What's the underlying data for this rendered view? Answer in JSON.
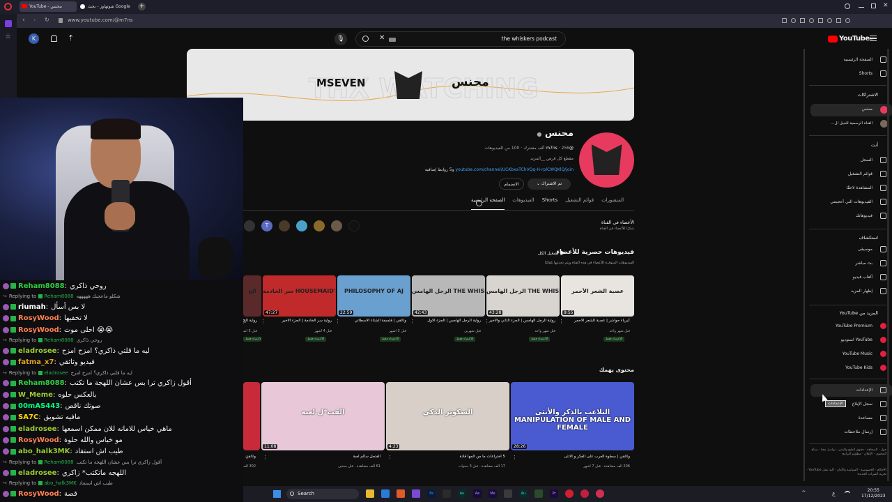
{
  "browser": {
    "tabs": [
      {
        "label": "YouTube - محنس"
      },
      {
        "label": "شوتهاوز - بحث Google"
      }
    ],
    "new_tab_symbol": "+",
    "url": "www.youtube.com/@m7ns",
    "profile_initial": "K"
  },
  "search": {
    "query": "the whiskers podcast"
  },
  "youtube_logo": {
    "text": "YouTube",
    "region": "SA"
  },
  "channel": {
    "name": "محنس",
    "handle": "@m7ns",
    "stats": "256 ألف مشترك · 100 من الفيديوهات",
    "description": "مقطع كل فرص __المزيد",
    "link": "youtube.com/channel/UCKbxaTChVQq-H-rplCWQKlQ/join",
    "link_suffix": "و5 روابط إضافية",
    "subscribed_label": "تم الاشتراك",
    "join_label": "الانضمام",
    "banner_logos": [
      "MSEVEN",
      "محنس"
    ],
    "tabs": [
      "الصفحة الرئيسية",
      "الفيديوهات",
      "Shorts",
      "قوائم التشغيل",
      "المنشورات"
    ]
  },
  "members": {
    "title": "الأعضاء في القناة",
    "subtitle": "شكرًا للأعضاء في القناة",
    "avatar_letter": "T"
  },
  "members_section": {
    "title": "فيديوهات حصرية للأعضاء",
    "play_all": "تشغيل الكل",
    "subtitle": "الفيديوهات المتوفرة للأعضاء في هذه القناة ويتم تحديثها تلقائيًا",
    "videos": [
      {
        "title": "كبرياء حواشر | عصبة الشعر الأحمر",
        "meta": "قبل شهر واحد",
        "duration": "9:55",
        "thumb_text": "عصبة الشعر الأحمر",
        "badge": "للأعضاء فقط"
      },
      {
        "title": "رواية الرجل الهامس | الجزء الثاني والأخير",
        "meta": "قبل شهر واحد",
        "duration": "43:28",
        "thumb_text": "الرجل الهامس THE WHISPER MAN",
        "badge": "للأعضاء فقط"
      },
      {
        "title": "رواية الرجل الهامس | الجزء الأول",
        "meta": "قبل شهرين",
        "duration": "42:43",
        "thumb_text": "الرجل الهامس THE WHISPER MAN",
        "badge": "للأعضاء فقط"
      },
      {
        "title": "وثائقي | فلسفة الشتاء الأسطاتي",
        "meta": "قبل 3 أشهر",
        "duration": "22:59",
        "thumb_text": "PHILOSOPHY OF AJ",
        "badge": "للأعضاء فقط"
      },
      {
        "title": "رواية سر الخادمة | الجزء الأخير",
        "meta": "قبل 4 أشهر",
        "duration": "47:27",
        "thumb_text": "سر الخادمة HOUSEMAID'S SECRET",
        "badge": "للأعضاء فقط"
      },
      {
        "title": "رواية الح",
        "meta": "قبل 5 أشهر",
        "duration": "",
        "thumb_text": "الح",
        "badge": "للأعضاء فقط"
      }
    ]
  },
  "for_you": {
    "title": "محتوى يهمك",
    "videos": [
      {
        "title": "وثائقي | سطوة العرب على الفكر و الأنثى",
        "meta": "206 ألف مشاهدة · قبل 7 أشهر",
        "duration": "28:26",
        "thumb_text": "التلاعب بالذكر والأنثى MANIPULATION OF MALE AND FEMALE"
      },
      {
        "title": "5 اختراعات ما من المها قادة",
        "meta": "17 ألف مشاهدة · قبل 3 سنوات",
        "duration": "4:23",
        "thumb_text": "السكوتر الذكي"
      },
      {
        "title": "الفتحل سالم لعبة",
        "meta": "61 ألف مشاهدة · قبل سنتين",
        "duration": "11:08",
        "thumb_text": "القت*ل لعبه"
      },
      {
        "title": "وثائقي",
        "meta": "302 ألف",
        "duration": "",
        "thumb_text": ""
      }
    ]
  },
  "sidebar": {
    "main": [
      {
        "label": "الصفحة الرئيسية",
        "icon": "home-icon"
      },
      {
        "label": "Shorts",
        "icon": "shorts-icon"
      }
    ],
    "subscriptions_header": "الاشتراكات",
    "subscriptions": [
      {
        "label": "محنس"
      },
      {
        "label": "القناة الرسمية للجيل ال..."
      }
    ],
    "you_header": "أنت",
    "you": [
      {
        "label": "السجل",
        "icon": "history-icon"
      },
      {
        "label": "قوائم التشغيل",
        "icon": "playlist-icon"
      },
      {
        "label": "المشاهدة لاحقًا",
        "icon": "clock-icon"
      },
      {
        "label": "الفيديوهات التي أعجبتني",
        "icon": "like-icon"
      },
      {
        "label": "فيديوهاتك",
        "icon": "video-icon"
      }
    ],
    "explore_header": "استكشاف",
    "explore": [
      {
        "label": "موسيقى",
        "icon": "music-icon"
      },
      {
        "label": "بث مباشر",
        "icon": "live-icon"
      },
      {
        "label": "ألعاب فيديو",
        "icon": "game-icon"
      },
      {
        "label": "إظهار المزيد",
        "icon": "chevron-down-icon"
      }
    ],
    "more_header": "المزيد من YouTube",
    "more": [
      {
        "label": "YouTube Premium"
      },
      {
        "label": "استوديو YouTube"
      },
      {
        "label": "YouTube Music"
      },
      {
        "label": "YouTube Kids"
      }
    ],
    "settings": [
      {
        "label": "الإعدادات",
        "icon": "gear-icon"
      },
      {
        "label": "سجل الإبلاغ",
        "icon": "flag-icon"
      },
      {
        "label": "مساعدة",
        "icon": "help-icon"
      },
      {
        "label": "إرسال ملاحظات",
        "icon": "feedback-icon"
      }
    ],
    "tooltip": "الإعدادات",
    "footer": "حول · الصحافة · حقوق الطبع والنشر · تواصل معنا · صناع المحتوى · الإعلان · مطوّرو البرامج",
    "footer2": "الأحكام · الخصوصية · السياسة والأمان · آلية عمل YouTube · تجربة الميزات الجديدة"
  },
  "chat": [
    {
      "type": "msg",
      "user": "Reham8088",
      "color": "#2ecc40",
      "text": "روحي ذاكري"
    },
    {
      "type": "reply",
      "to": "Reham8088",
      "text": "شكلو ماعجبك هههههه"
    },
    {
      "type": "msg",
      "user": "riumah",
      "color": "#ffffff",
      "text": "لا بس أسأل"
    },
    {
      "type": "msg",
      "user": "RosyWood",
      "color": "#ff7f50",
      "text": "لا تخفيها"
    },
    {
      "type": "msg",
      "user": "RosyWood",
      "color": "#ff7f50",
      "text": "احلى موت 😭😭"
    },
    {
      "type": "reply",
      "to": "Reham8088",
      "text": "روحي ذاكري"
    },
    {
      "type": "msg",
      "user": "eladrosee",
      "color": "#9acd32",
      "text": "ليه ما قلتي ذاكري؟ امزح امزح"
    },
    {
      "type": "msg",
      "user": "fatma_x7",
      "color": "#daa520",
      "text": "فيديو وثائقي"
    },
    {
      "type": "reply",
      "to": "eladrosee",
      "text": "ليه ما قلتي ذاكري؟ امزح امزح"
    },
    {
      "type": "msg",
      "user": "Reham8088",
      "color": "#2ecc40",
      "text": "أقول زاكري ترا بس عشان اللهجة ما تكتب"
    },
    {
      "type": "msg",
      "user": "W_Meme",
      "color": "#9acd32",
      "text": "بالعكس حلوه"
    },
    {
      "type": "msg",
      "user": "00mAS443",
      "color": "#00ff7f",
      "text": "صوتك ناقص"
    },
    {
      "type": "msg",
      "user": "SA7C",
      "color": "#ffd700",
      "text": "مافيه تشويق"
    },
    {
      "type": "msg",
      "user": "eladrosee",
      "color": "#9acd32",
      "text": "ماهي خياس للامانه للان ممكن اسمعها"
    },
    {
      "type": "msg",
      "user": "RosyWood",
      "color": "#ff7f50",
      "text": "مو خياس والله حلوة"
    },
    {
      "type": "msg",
      "user": "abo_halk3MK",
      "color": "#9acd32",
      "text": "طيب اش استفاد"
    },
    {
      "type": "reply",
      "to": "Reham8088",
      "text": "أقول زاكري ترا بس عشان اللهجة ما تكتب"
    },
    {
      "type": "msg",
      "user": "eladrosee",
      "color": "#9acd32",
      "text": "اللهجه ماتكتب* زاكري"
    },
    {
      "type": "reply",
      "to": "abo_halk3MK",
      "text": "طيب اش استفاد"
    },
    {
      "type": "msg",
      "user": "RosyWood",
      "color": "#ff7f50",
      "text": "قصة"
    }
  ],
  "chat_labels": {
    "replying_to": "Replying to"
  },
  "taskbar": {
    "search_label": "Search",
    "time": "20:55",
    "date": "17/12/2023",
    "lang": "ع",
    "apps": [
      "Ps",
      "Au",
      "Ae",
      "Me",
      "Au",
      "Pr"
    ]
  }
}
